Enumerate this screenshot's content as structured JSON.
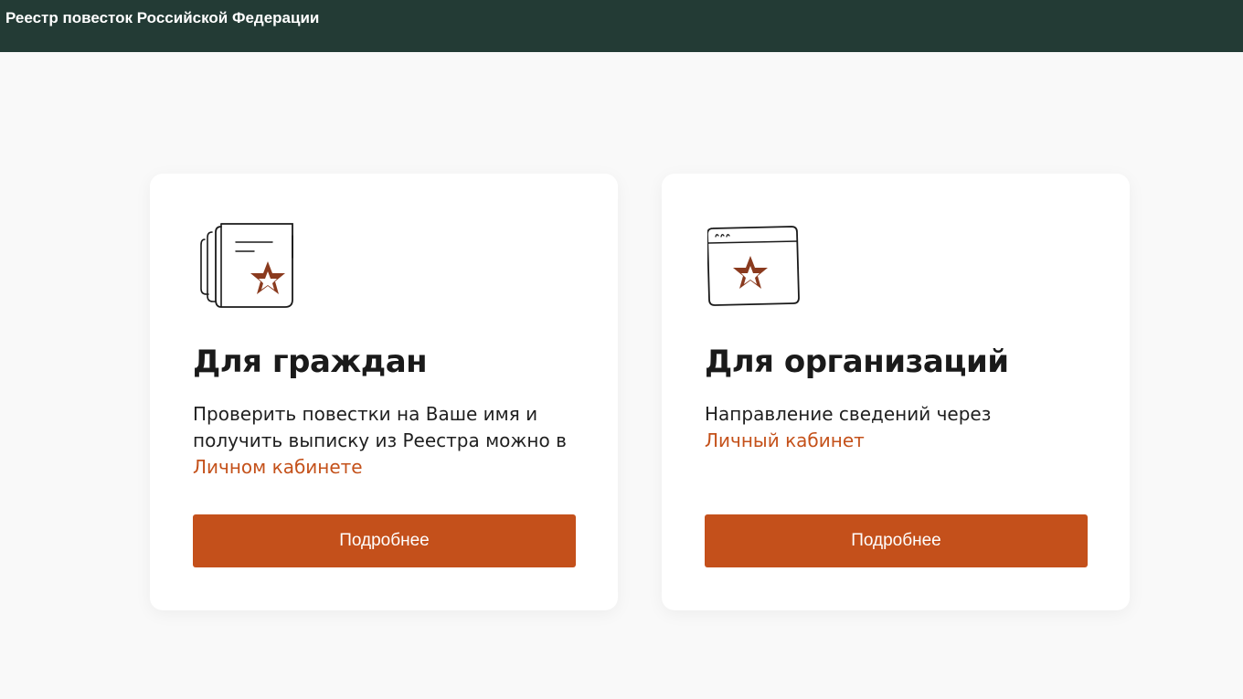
{
  "header": {
    "title": "Реестр повесток Российской Федерации"
  },
  "colors": {
    "header_bg": "#233b35",
    "accent": "#c4501b",
    "page_bg": "#f9f9f9"
  },
  "cards": [
    {
      "icon": "summons-document-star-icon",
      "title": "Для граждан",
      "text_before_link": "Проверить повестки на Ваше имя и получить выписку из Реестра можно в ",
      "link_label": "Личном кабинете",
      "button_label": "Подробнее"
    },
    {
      "icon": "browser-window-star-icon",
      "title": "Для организаций",
      "text_before_link": "Направление сведений через ",
      "link_label": "Личный кабинет",
      "button_label": "Подробнее"
    }
  ]
}
